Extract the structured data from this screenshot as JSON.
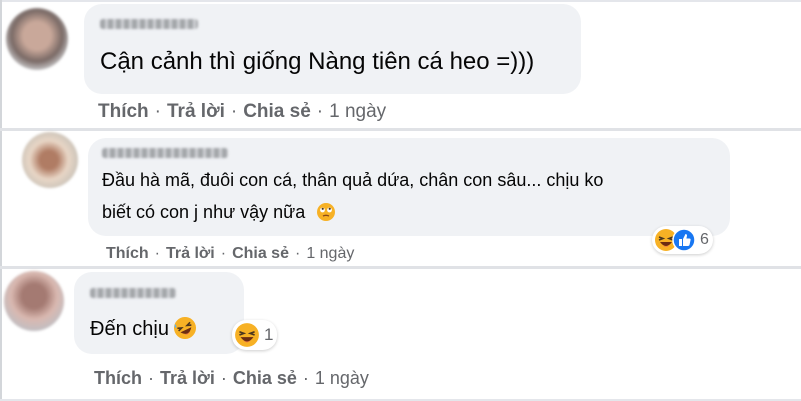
{
  "comments": [
    {
      "text": "Cận cảnh thì giống Nàng tiên cá heo =)))",
      "actions": {
        "like": "Thích",
        "reply": "Trả lời",
        "share": "Chia sẻ",
        "time": "1 ngày"
      }
    },
    {
      "text_line1": "Đầu hà mã, đuôi con cá, thân quả dứa, chân con sâu... chịu ko",
      "text_line2": "biết có con j như vậy nữa",
      "reaction_count": "6",
      "actions": {
        "like": "Thích",
        "reply": "Trả lời",
        "share": "Chia sẻ",
        "time": "1 ngày"
      }
    },
    {
      "text": "Đến chịu",
      "reaction_count": "1",
      "actions": {
        "like": "Thích",
        "reply": "Trả lời",
        "share": "Chia sẻ",
        "time": "1 ngày"
      }
    }
  ],
  "separator": "·",
  "icons": {
    "laugh": "haha-reaction-icon",
    "like": "like-reaction-icon",
    "eye_roll": "eye-roll-emoji-icon",
    "rofl": "rofl-emoji-icon"
  },
  "colors": {
    "bubble": "#f0f2f5",
    "meta_text": "#65676b",
    "like_blue": "#1877f2",
    "emoji_yellow": "#f7b125"
  }
}
